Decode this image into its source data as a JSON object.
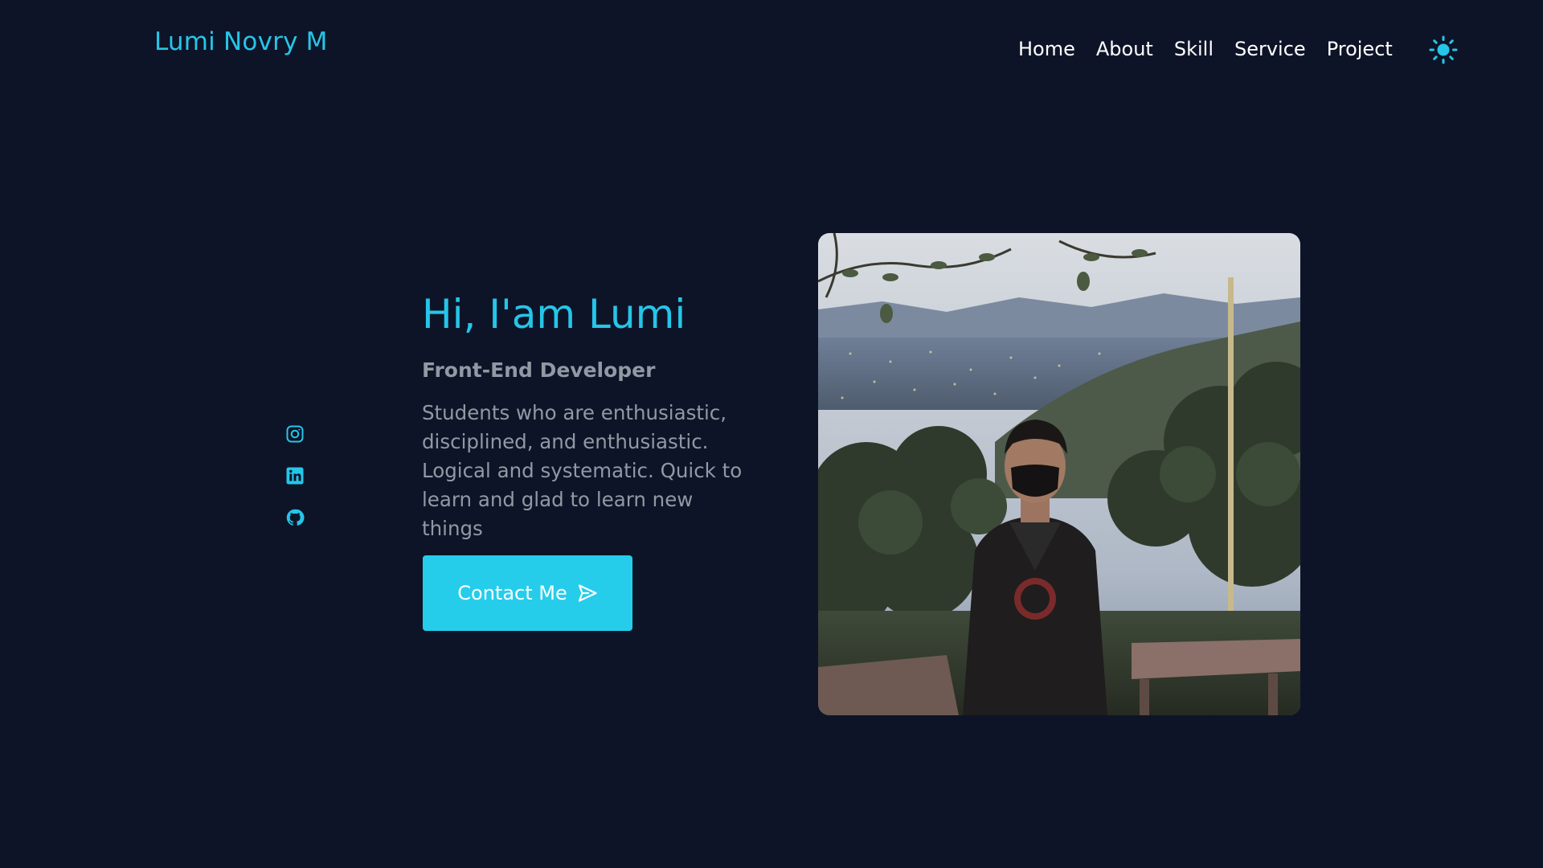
{
  "header": {
    "logo": "Lumi Novry M",
    "nav": [
      "Home",
      "About",
      "Skill",
      "Service",
      "Project"
    ],
    "theme_icon": "sun-icon"
  },
  "socials": [
    {
      "name": "instagram",
      "icon": "instagram-icon"
    },
    {
      "name": "linkedin",
      "icon": "linkedin-icon"
    },
    {
      "name": "github",
      "icon": "github-icon"
    }
  ],
  "hero": {
    "title": "Hi, I'am Lumi",
    "subtitle": "Front-End Developer",
    "description": "Students who are enthusiastic, disciplined, and enthusiastic. Logical and systematic. Quick to learn and glad to learn new things",
    "button_label": "Contact Me",
    "button_icon": "send-icon"
  },
  "colors": {
    "background": "#0e1428",
    "accent": "#25c6e8",
    "button": "#25cdeb",
    "muted_text": "#8f9aa3",
    "nav_text": "#ffffff"
  }
}
